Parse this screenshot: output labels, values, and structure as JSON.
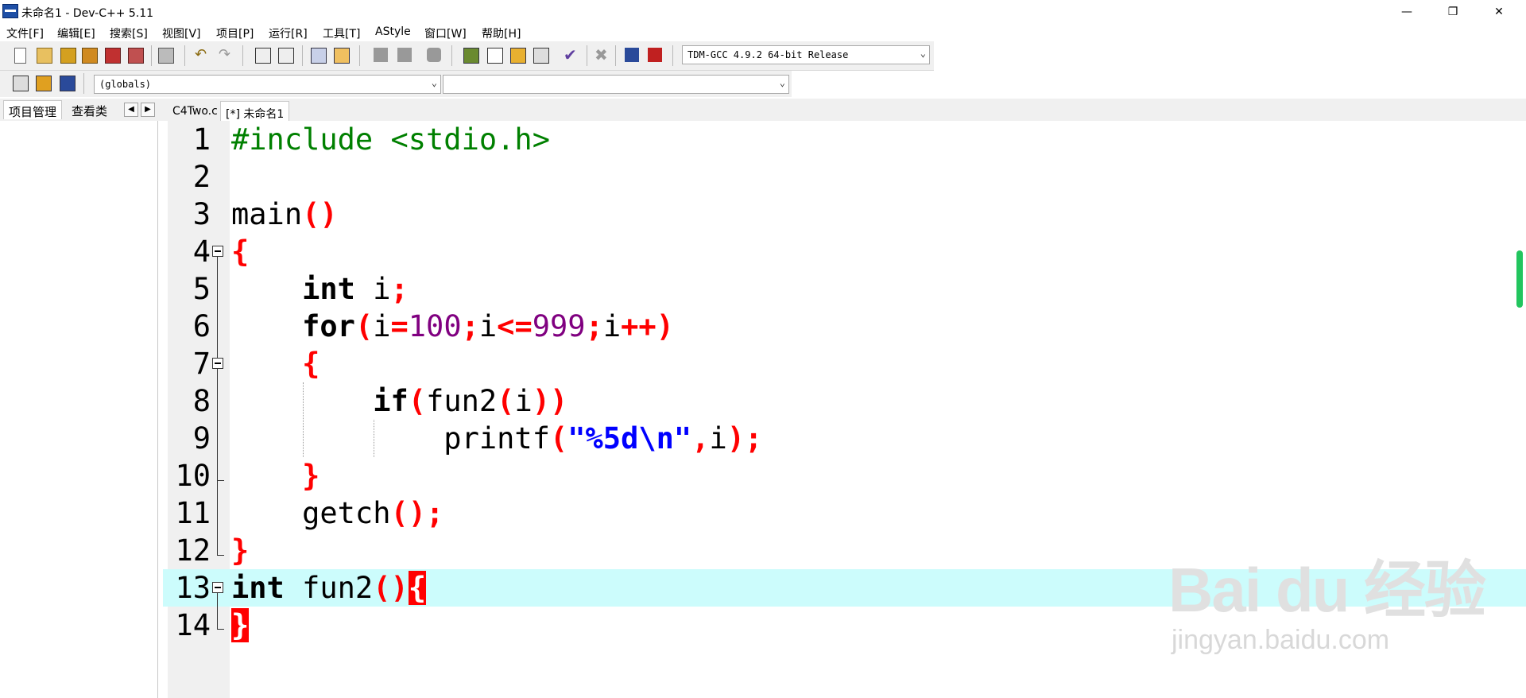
{
  "window": {
    "title": "未命名1 - Dev-C++ 5.11",
    "minimize_icon": "minimize-icon",
    "restore_icon": "restore-icon",
    "close_icon": "close-icon"
  },
  "menu": [
    "文件[F]",
    "编辑[E]",
    "搜索[S]",
    "视图[V]",
    "项目[P]",
    "运行[R]",
    "工具[T]",
    "AStyle",
    "窗口[W]",
    "帮助[H]"
  ],
  "toolbar": {
    "compiler_select": "TDM-GCC 4.9.2 64-bit Release",
    "scope_select": "(globals)",
    "member_select": ""
  },
  "left_tabs": [
    "项目管理",
    "查看类"
  ],
  "editor_tabs": [
    "C4Two.c",
    "[*] 未命名1"
  ],
  "editor": {
    "line_numbers": [
      "1",
      "2",
      "3",
      "4",
      "5",
      "6",
      "7",
      "8",
      "9",
      "10",
      "11",
      "12",
      "13",
      "14"
    ],
    "highlighted_line": 13
  },
  "watermark": {
    "logo": "Bai du 经验",
    "url": "jingyan.baidu.com"
  }
}
